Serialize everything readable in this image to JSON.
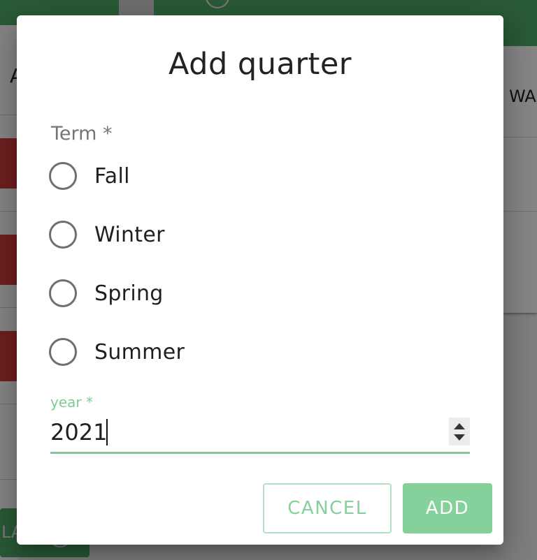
{
  "background": {
    "left_letter": "A",
    "right_text": "WA",
    "bottom_button_text": "LA"
  },
  "dialog": {
    "title": "Add quarter",
    "term_label": "Term *",
    "terms": [
      {
        "label": "Fall",
        "selected": false
      },
      {
        "label": "Winter",
        "selected": false
      },
      {
        "label": "Spring",
        "selected": false
      },
      {
        "label": "Summer",
        "selected": false
      }
    ],
    "year_label": "year *",
    "year_value": "2021",
    "cancel_label": "CANCEL",
    "add_label": "ADD"
  },
  "colors": {
    "accent": "#86d09c",
    "header_green": "#4fae6a",
    "row_red": "#d53c3c"
  }
}
